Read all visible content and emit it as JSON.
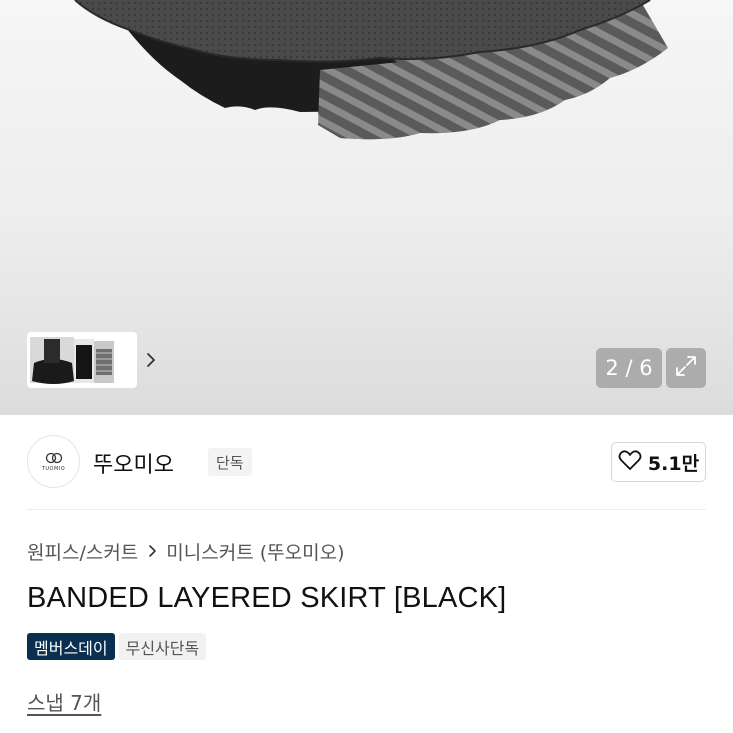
{
  "gallery": {
    "counter_text": "2 / 6",
    "current_index": 2,
    "total": 6
  },
  "brand": {
    "name": "뚜오미오",
    "exclusive_tag": "단독",
    "logo_text": "TUOMIO",
    "like_count": "5.1만"
  },
  "breadcrumb": {
    "category": "원피스/스커트",
    "subcategory": "미니스커트 (뚜오미오)"
  },
  "product": {
    "title": "BANDED LAYERED SKIRT [BLACK]",
    "badges": [
      "멤버스데이",
      "무신사단독"
    ]
  },
  "snap": {
    "label": "스냅 7개"
  },
  "icons": {
    "thumb_next": "chevron-right-icon",
    "expand": "expand-icon",
    "like": "heart-icon",
    "crumb_sep": "chevron-right-icon"
  },
  "colors": {
    "member_badge": "#0b2f50",
    "text_primary": "#111111",
    "text_secondary": "#555555"
  }
}
